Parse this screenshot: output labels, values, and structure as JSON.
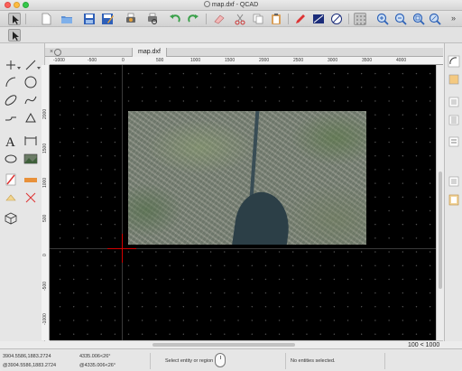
{
  "window": {
    "title": "map.dxf - QCAD"
  },
  "toolbar": {
    "buttons": [
      "select-arrow-icon",
      "new-file-icon",
      "open-folder-icon",
      "save-icon",
      "save-as-icon",
      "print-icon",
      "print-preview-icon",
      "undo-icon",
      "redo-icon",
      "cut-icon",
      "copy-icon",
      "paste-icon",
      "pen-icon",
      "layer-icon",
      "no-entry-icon",
      "grid-icon",
      "zoom-in-icon",
      "zoom-out-icon",
      "zoom-auto-icon",
      "zoom-window-icon",
      "zoom-pan-icon"
    ],
    "overflow": "»"
  },
  "tab": {
    "label": "map.dxf"
  },
  "ruler": {
    "h_ticks": [
      "-1000",
      "-500",
      "0",
      "500",
      "1000",
      "1500",
      "2000",
      "2500",
      "3000",
      "3500",
      "4000"
    ],
    "v_ticks": [
      "2000",
      "1500",
      "1000",
      "500",
      "0",
      "-500",
      "-1000"
    ]
  },
  "view": {
    "zoom": "100 < 1000"
  },
  "status": {
    "coord_abs": "3904.5586,1883.2724",
    "coord_abs_alt": "@3904.5586,1883.2724",
    "coord_polar": "4335.006<26°",
    "coord_polar_alt": "@4335.006<26°",
    "hint": "Select entity or region",
    "selection": "No entities selected."
  },
  "colors": {
    "canvas_bg": "#000000",
    "crosshair": "#d40000",
    "grid_dot": "#6a6a6a"
  }
}
